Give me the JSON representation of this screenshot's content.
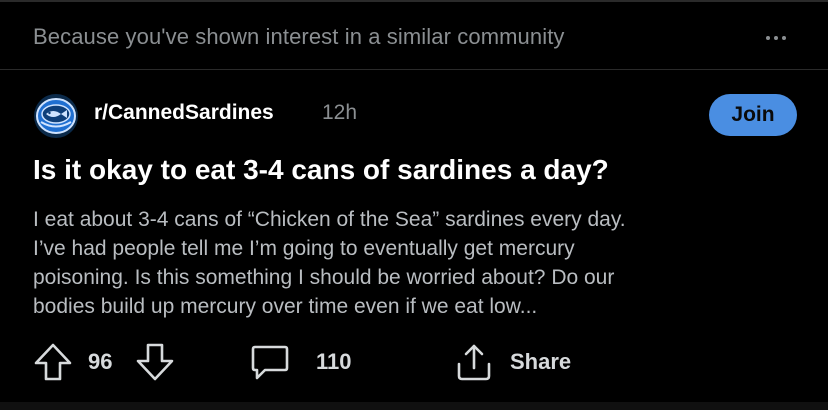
{
  "feed": {
    "recommendation_text": "Because you've shown interest in a similar community"
  },
  "post": {
    "community": "r/CannedSardines",
    "age": "12h",
    "join_label": "Join",
    "title": "Is it okay to eat 3-4 cans of sardines a day?",
    "body_lines": [
      "I eat about 3-4 cans of “Chicken of the Sea” sardines every day.",
      "I’ve had people tell me I’m going to eventually get mercury",
      "poisoning. Is this something I should be worried about? Do our",
      "bodies build up mercury over time even if we eat low..."
    ],
    "votes": "96",
    "comments": "110",
    "share_label": "Share"
  },
  "colors": {
    "background": "#000000",
    "join_button": "#4a8ee2",
    "text_primary": "#ffffff",
    "text_secondary": "#8b8f92"
  },
  "icons": [
    "more-dots-icon",
    "community-avatar-icon",
    "upvote-icon",
    "downvote-icon",
    "comment-icon",
    "share-icon"
  ]
}
